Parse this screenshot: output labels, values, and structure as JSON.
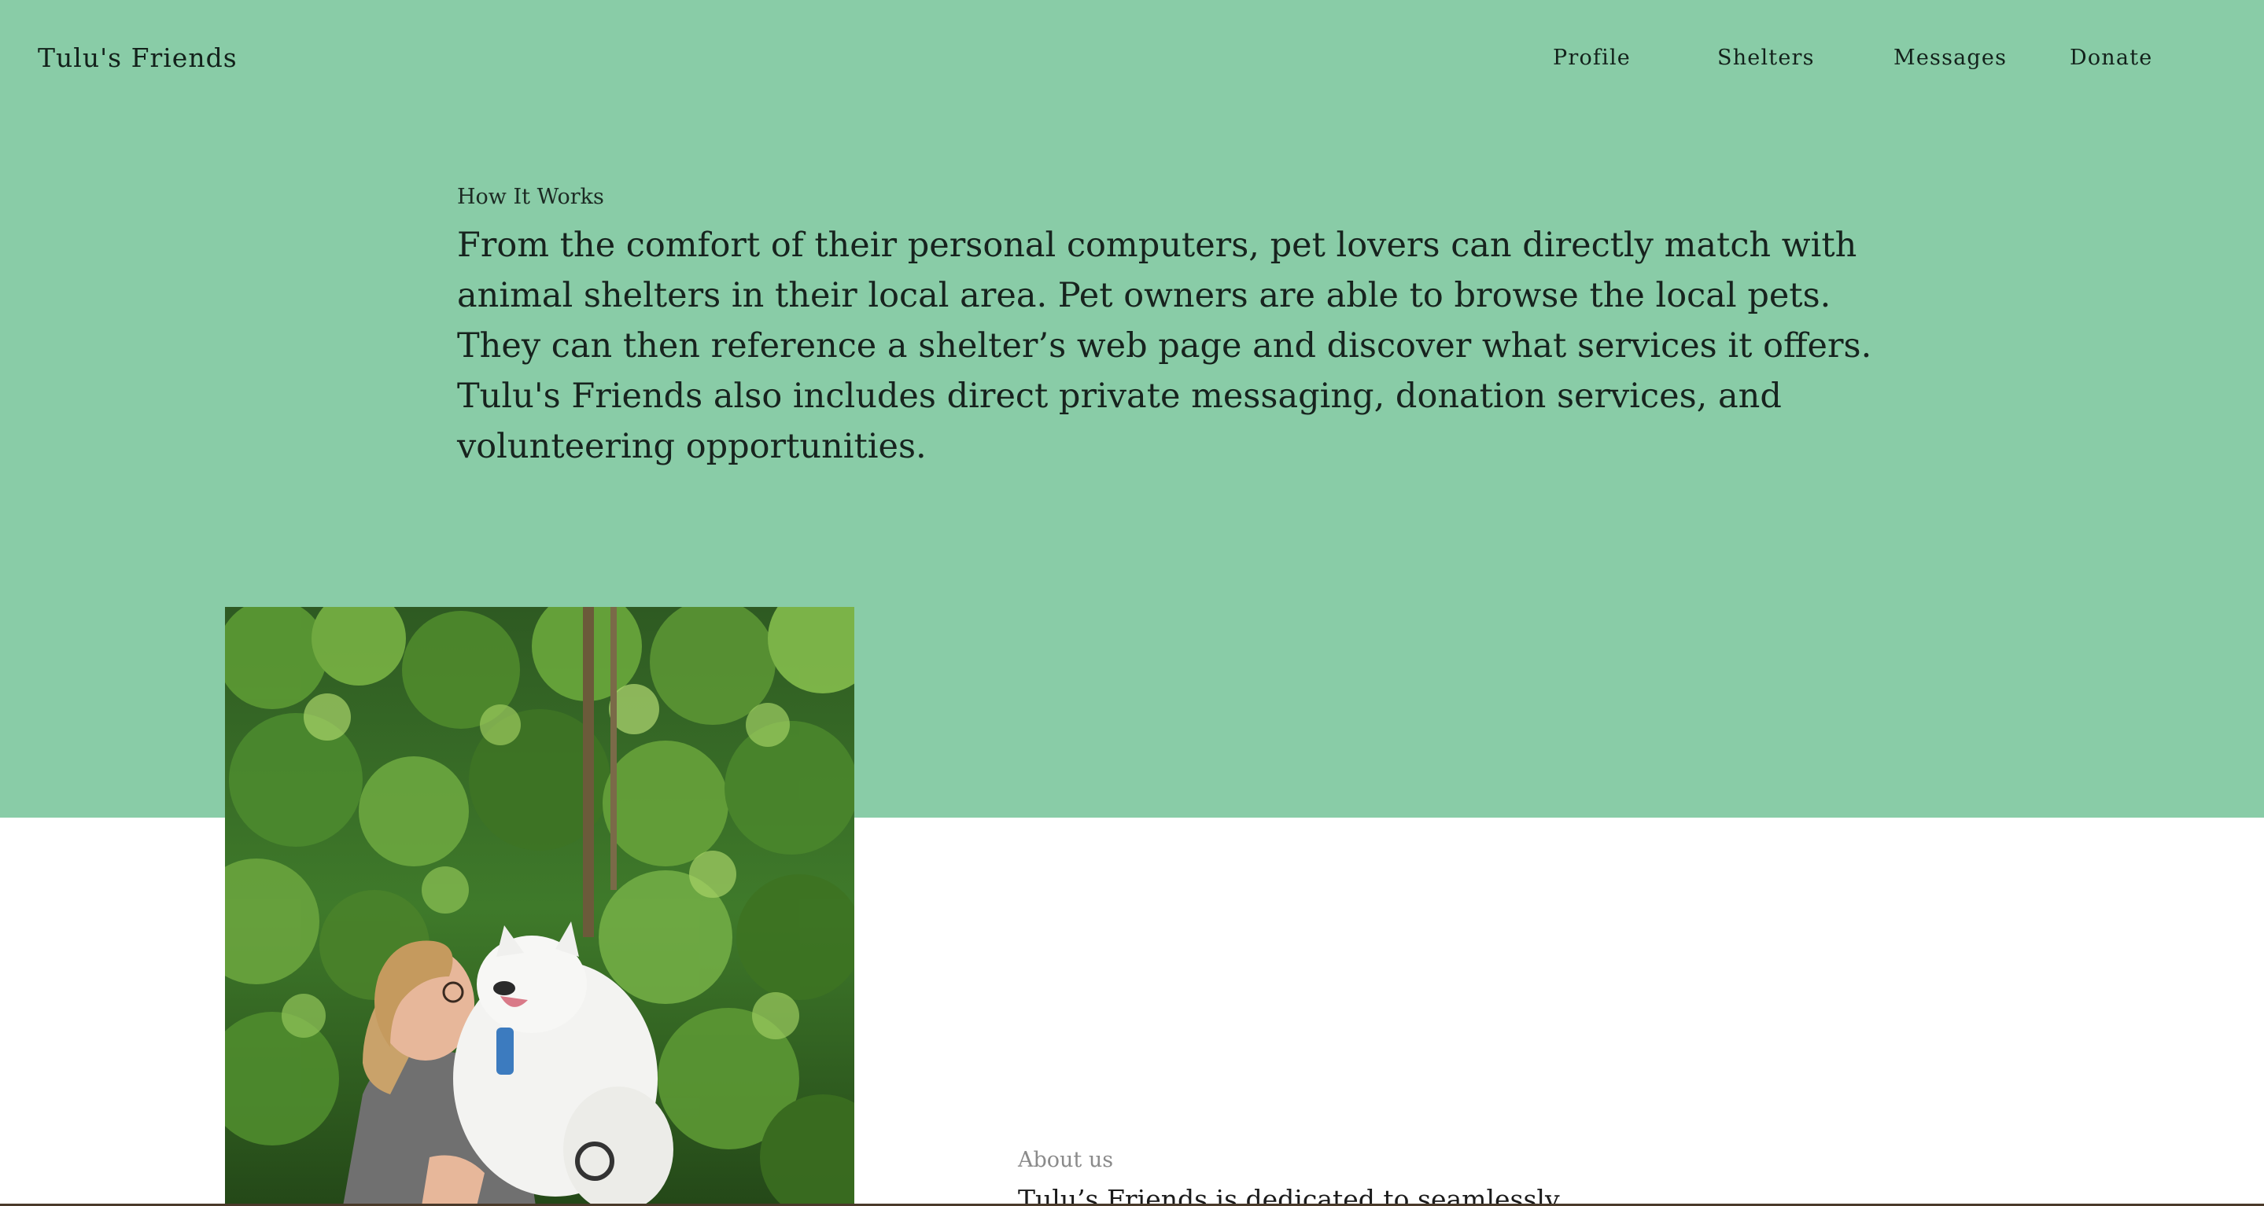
{
  "header": {
    "brand": "Tulu's Friends",
    "nav": [
      {
        "label": "Profile"
      },
      {
        "label": "Shelters"
      },
      {
        "label": "Messages"
      },
      {
        "label": "Donate"
      }
    ]
  },
  "how_it_works": {
    "label": "How It Works",
    "lines": [
      "From the comfort of their personal computers, pet lovers can directly match with",
      "animal shelters in their local area. Pet owners are able to browse the local pets.",
      "They can then reference a shelter’s web page and discover what services it offers.",
      "Tulu's Friends also includes direct private messaging, donation services, and",
      "volunteering opportunities."
    ]
  },
  "photo": {
    "icon": "woman-holding-white-dog-photo"
  },
  "about": {
    "label": "About us",
    "text": "Tulu’s Friends is dedicated to seamlessly"
  },
  "colors": {
    "hero_background": "#89cca7",
    "text": "#17231e",
    "muted_label": "#8a8a8a"
  }
}
